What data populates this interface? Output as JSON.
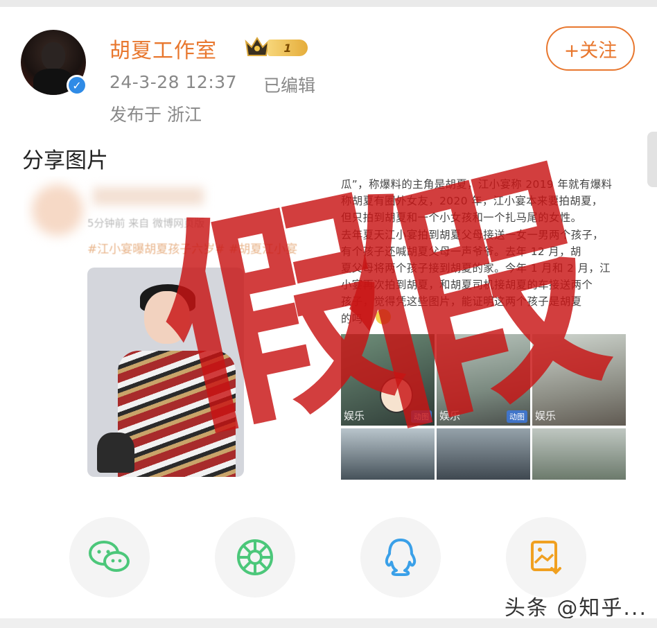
{
  "post": {
    "username": "胡夏工作室",
    "level_badge": "1",
    "time": "24-3-28 12:37",
    "edited": "已编辑",
    "location": "发布于 浙江",
    "follow_label": "+关注",
    "text": "分享图片"
  },
  "left_image": {
    "meta": "5分钟前  来自 微博网页版",
    "hashtag": "#江小宴曝胡夏孩子六岁#  #胡夏江小宴"
  },
  "right_image": {
    "article_lines": [
      "瓜”，称爆料的主角是胡夏，江小宴称 2019 年就有爆料",
      "称胡夏有圈外女友，2020 年，江小宴本来要拍胡夏，",
      "但只拍到胡夏和一个小女孩和一个扎马尾的女性。",
      "去年夏天江小宴拍到胡夏父母接送一女一男两个孩子，",
      "有个孩子还喊胡夏父母一声爷爷。去年 12 月，胡",
      "夏父母将两个孩子接到胡夏的家。今年 1 月和 2 月，江",
      "小宴再次拍到胡夏，和胡夏司机接胡夏的车接送两个",
      "孩子，觉得凭这些图片，能证明这两个孩子是胡夏",
      "的吗"
    ],
    "cells": [
      {
        "label": "娱乐",
        "badge": "动图"
      },
      {
        "label": "娱乐",
        "badge": "动图"
      },
      {
        "label": "娱乐",
        "badge": ""
      },
      {
        "label": "",
        "badge": ""
      },
      {
        "label": "",
        "badge": ""
      },
      {
        "label": "",
        "badge": ""
      }
    ]
  },
  "stamp": {
    "char_left": "假",
    "char_right": "假"
  },
  "share": {
    "wechat_icon": "wechat-icon",
    "moments_icon": "moments-icon",
    "qq_icon": "qq-icon",
    "save_icon": "save-image-icon",
    "colors": {
      "wechat": "#4cc77a",
      "moments": "#4cc77a",
      "qq": "#3aa0e8",
      "save": "#f0a020"
    }
  },
  "watermark": "头条 @知乎...",
  "colors": {
    "accent": "#e8772e",
    "verified": "#2f8be6",
    "stamp": "#c81414"
  }
}
